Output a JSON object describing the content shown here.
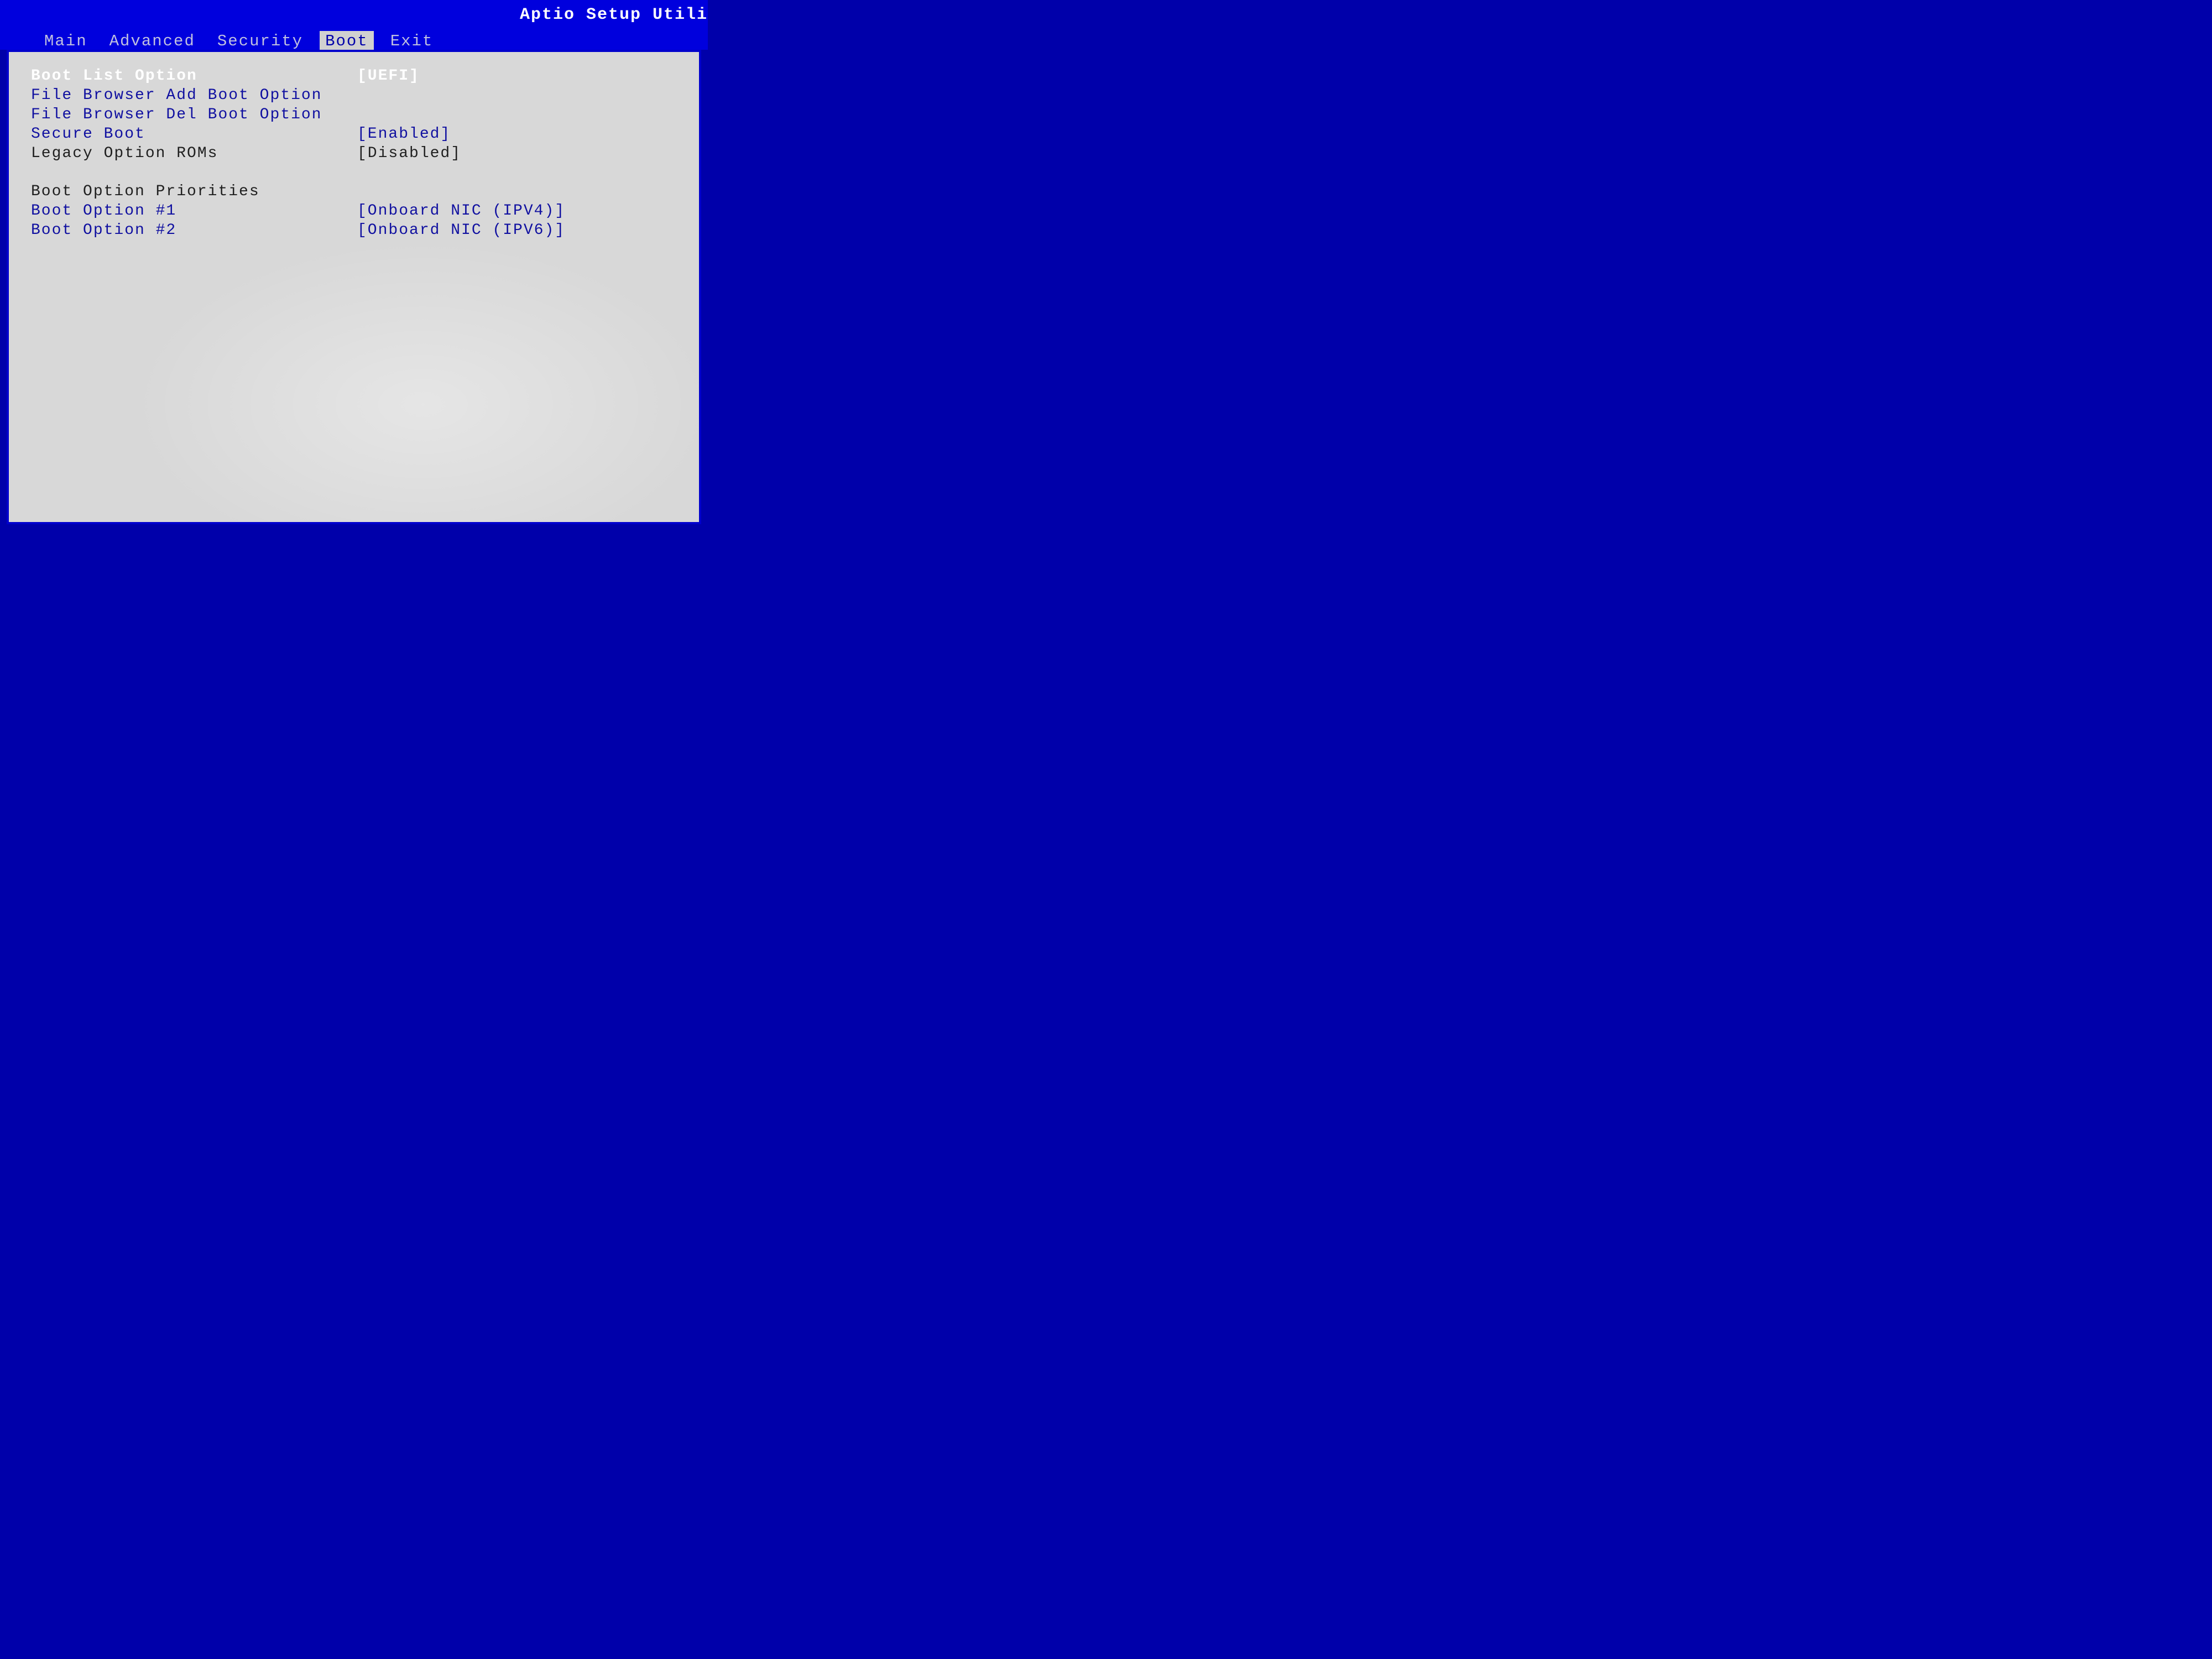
{
  "header": {
    "utility_title": "Aptio Setup Utili",
    "tabs": [
      "Main",
      "Advanced",
      "Security",
      "Boot",
      "Exit"
    ],
    "active_tab_index": 3
  },
  "boot_page": {
    "boot_list_option": {
      "label": "Boot List Option",
      "value": "[UEFI]"
    },
    "file_browser_add": "File Browser Add Boot Option",
    "file_browser_del": "File Browser Del Boot Option",
    "secure_boot": {
      "label": "Secure Boot",
      "value": "[Enabled]"
    },
    "legacy_option_roms": {
      "label": "Legacy Option ROMs",
      "value": "[Disabled]"
    },
    "priorities_header": "Boot Option Priorities",
    "boot_option_1": {
      "label": "Boot Option #1",
      "value": "[Onboard NIC (IPV4)]"
    },
    "boot_option_2": {
      "label": "Boot Option #2",
      "value": "[Onboard NIC (IPV6)]"
    }
  }
}
